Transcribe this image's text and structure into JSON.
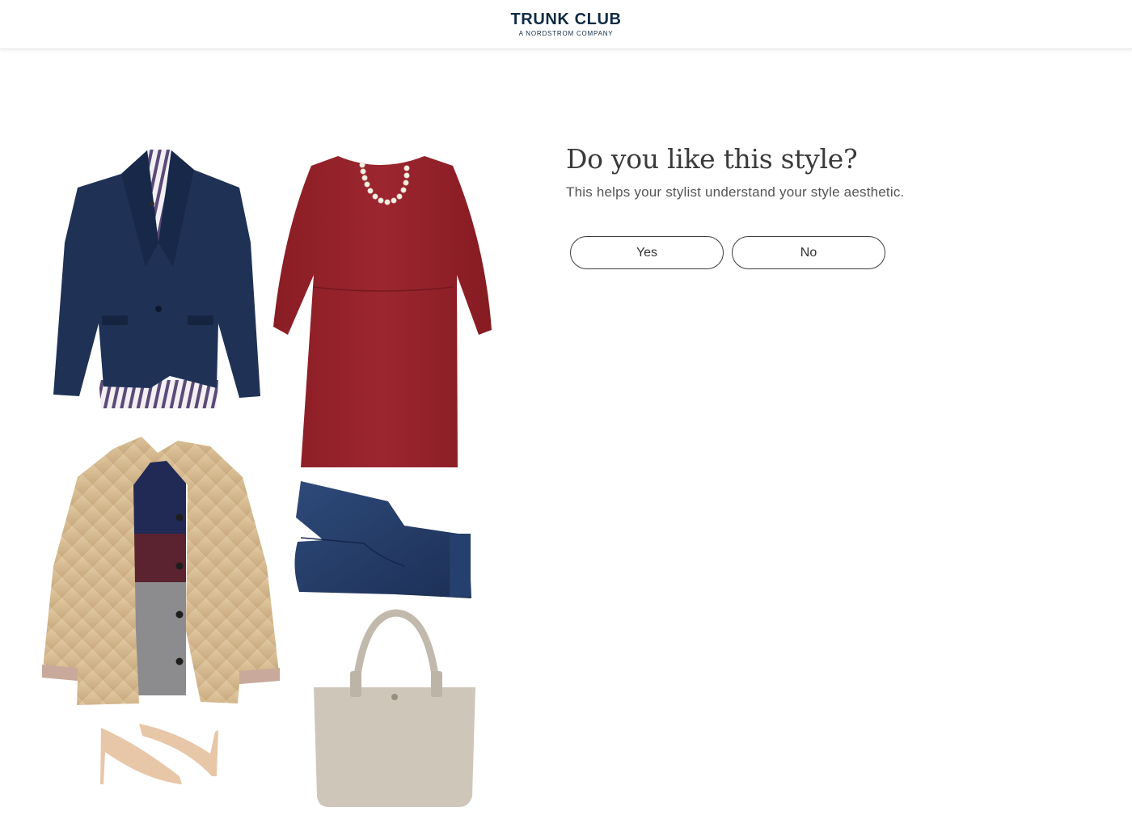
{
  "header": {
    "logo_main": "TRUNK CLUB",
    "logo_sub": "A NORDSTROM COMPANY"
  },
  "question": {
    "title": "Do you like this style?",
    "subtitle": "This helps your stylist understand your style aesthetic.",
    "yes_label": "Yes",
    "no_label": "No"
  },
  "collage": {
    "items": [
      "navy-blazer",
      "striped-shirt",
      "red-dress",
      "pearl-necklace",
      "quilted-jacket",
      "navy-sweater",
      "dark-jeans",
      "nude-heels",
      "tote-bag"
    ]
  },
  "colors": {
    "brand_navy": "#0f2b44",
    "button_border": "#3d3d3d",
    "title_text": "#3a3a3a"
  }
}
